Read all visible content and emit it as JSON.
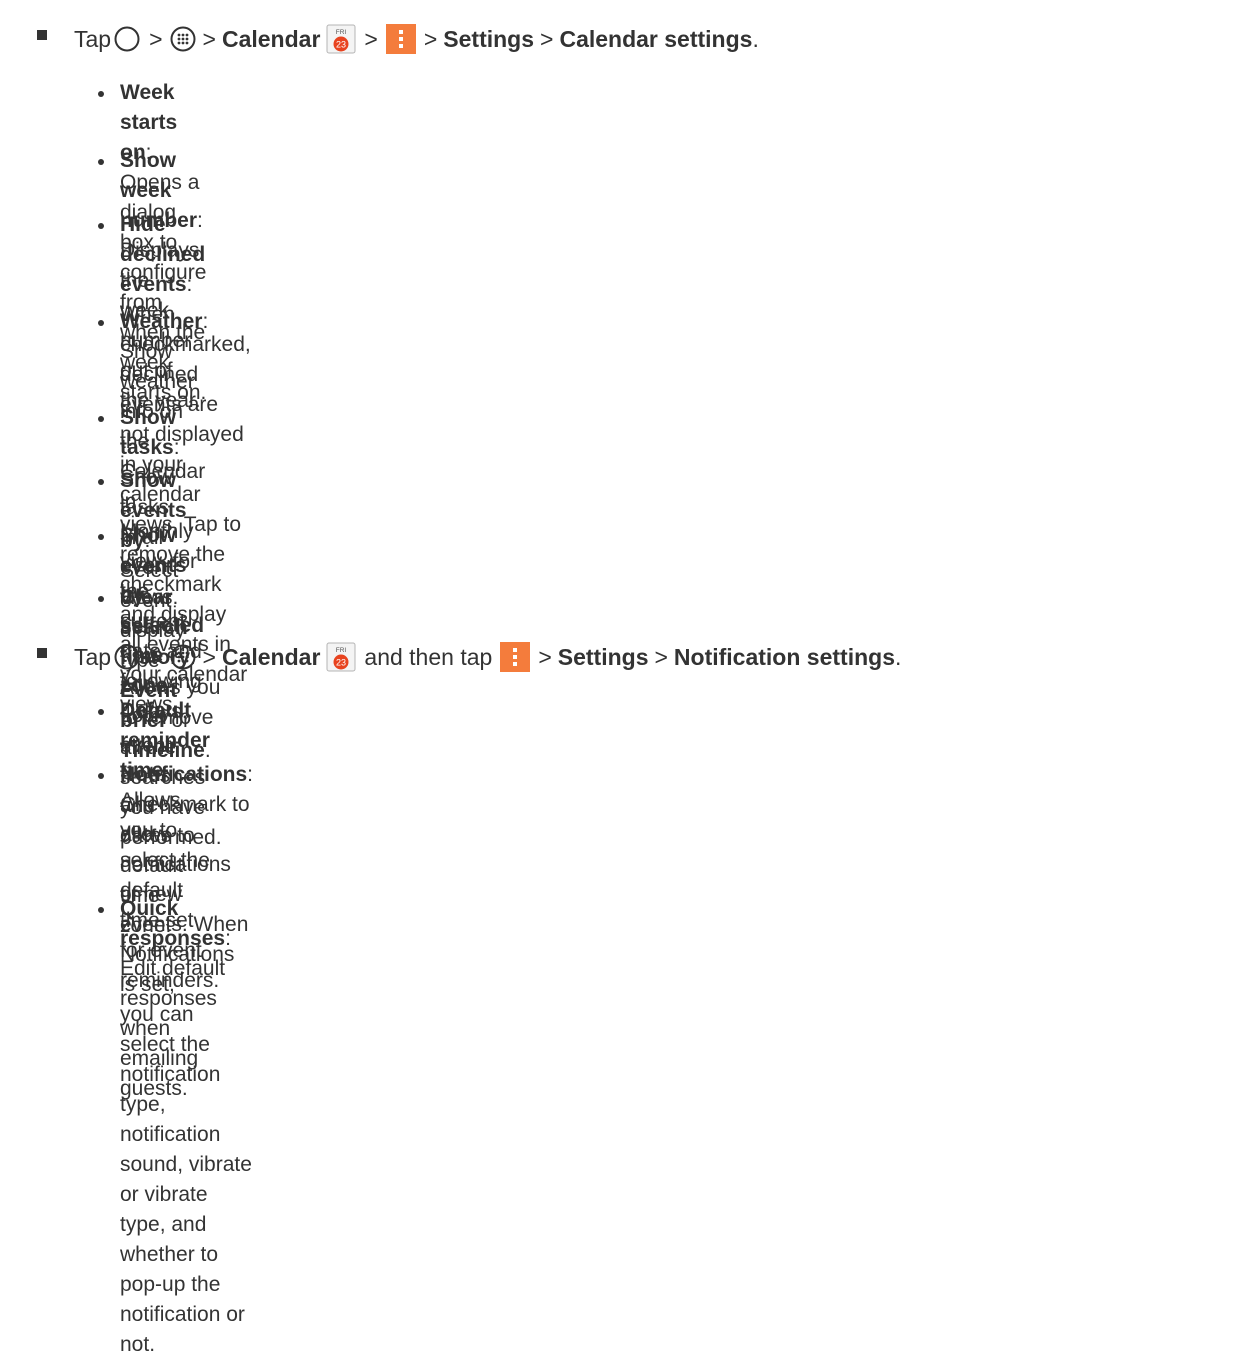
{
  "step1": {
    "tap": "Tap",
    "sep": ">",
    "calendar": "Calendar",
    "cal_icon_day": "FRI",
    "cal_icon_date": "23",
    "settings": "Settings",
    "calendar_settings": "Calendar settings",
    "end": "."
  },
  "step1_items": [
    {
      "label": "Week starts on",
      "text": ": Opens a dialog box to configure from when the week starts on."
    },
    {
      "label": "Show week number",
      "text": ": Displays the week number out of the year."
    },
    {
      "label": "Hide declined events",
      "text": ": When checkmarked, declined events are not displayed in your\ncalendar views. Tap to remove the checkmark and display all events in your calendar views."
    },
    {
      "label": "Weather",
      "text": ": Show weather info on the Calendar in Monthly view, for the current date and\nfollowing 4 days."
    },
    {
      "label": "Show tasks",
      "text": ": Show tasks in all event views."
    },
    {
      "label": "Show events by",
      "text_a": ": Select event display type ",
      "bold_b": "Event brief",
      "text_c": " or ",
      "bold_d": "Timeline",
      "text_e": "."
    },
    {
      "label": "Show events by selected time zone",
      "text": ": Lock event times and dates to default time zone."
    },
    {
      "label": "Clear search history",
      "text": ": Allows you to remove all the searches you have performed."
    }
  ],
  "step2": {
    "tap": "Tap",
    "sep": ">",
    "calendar": "Calendar",
    "cal_icon_day": "FRI",
    "cal_icon_date": "23",
    "and_then_tap": "and then tap",
    "settings": "Settings",
    "notification_settings": "Notification settings",
    "end": "."
  },
  "step2_items": [
    {
      "label": "Default reminder time",
      "text": ": Allows you to select the default time set for event reminders."
    },
    {
      "label": "Notifications",
      "text": ": Checkmark to allow notifications of new events. When Notifications is set,\nyou can select the notification type, notification sound, vibrate or vibrate type, and whether to\npop-up the notification or not."
    },
    {
      "label": "Quick responses",
      "text": ": Edit default responses when emailing guests."
    }
  ],
  "colors": {
    "text": "#333333",
    "menu_icon": "#f47c3c",
    "calendar_red": "#e8431f"
  },
  "icons": [
    "home-circle-icon",
    "apps-grid-icon",
    "calendar-app-icon",
    "menu-kebab-icon"
  ]
}
